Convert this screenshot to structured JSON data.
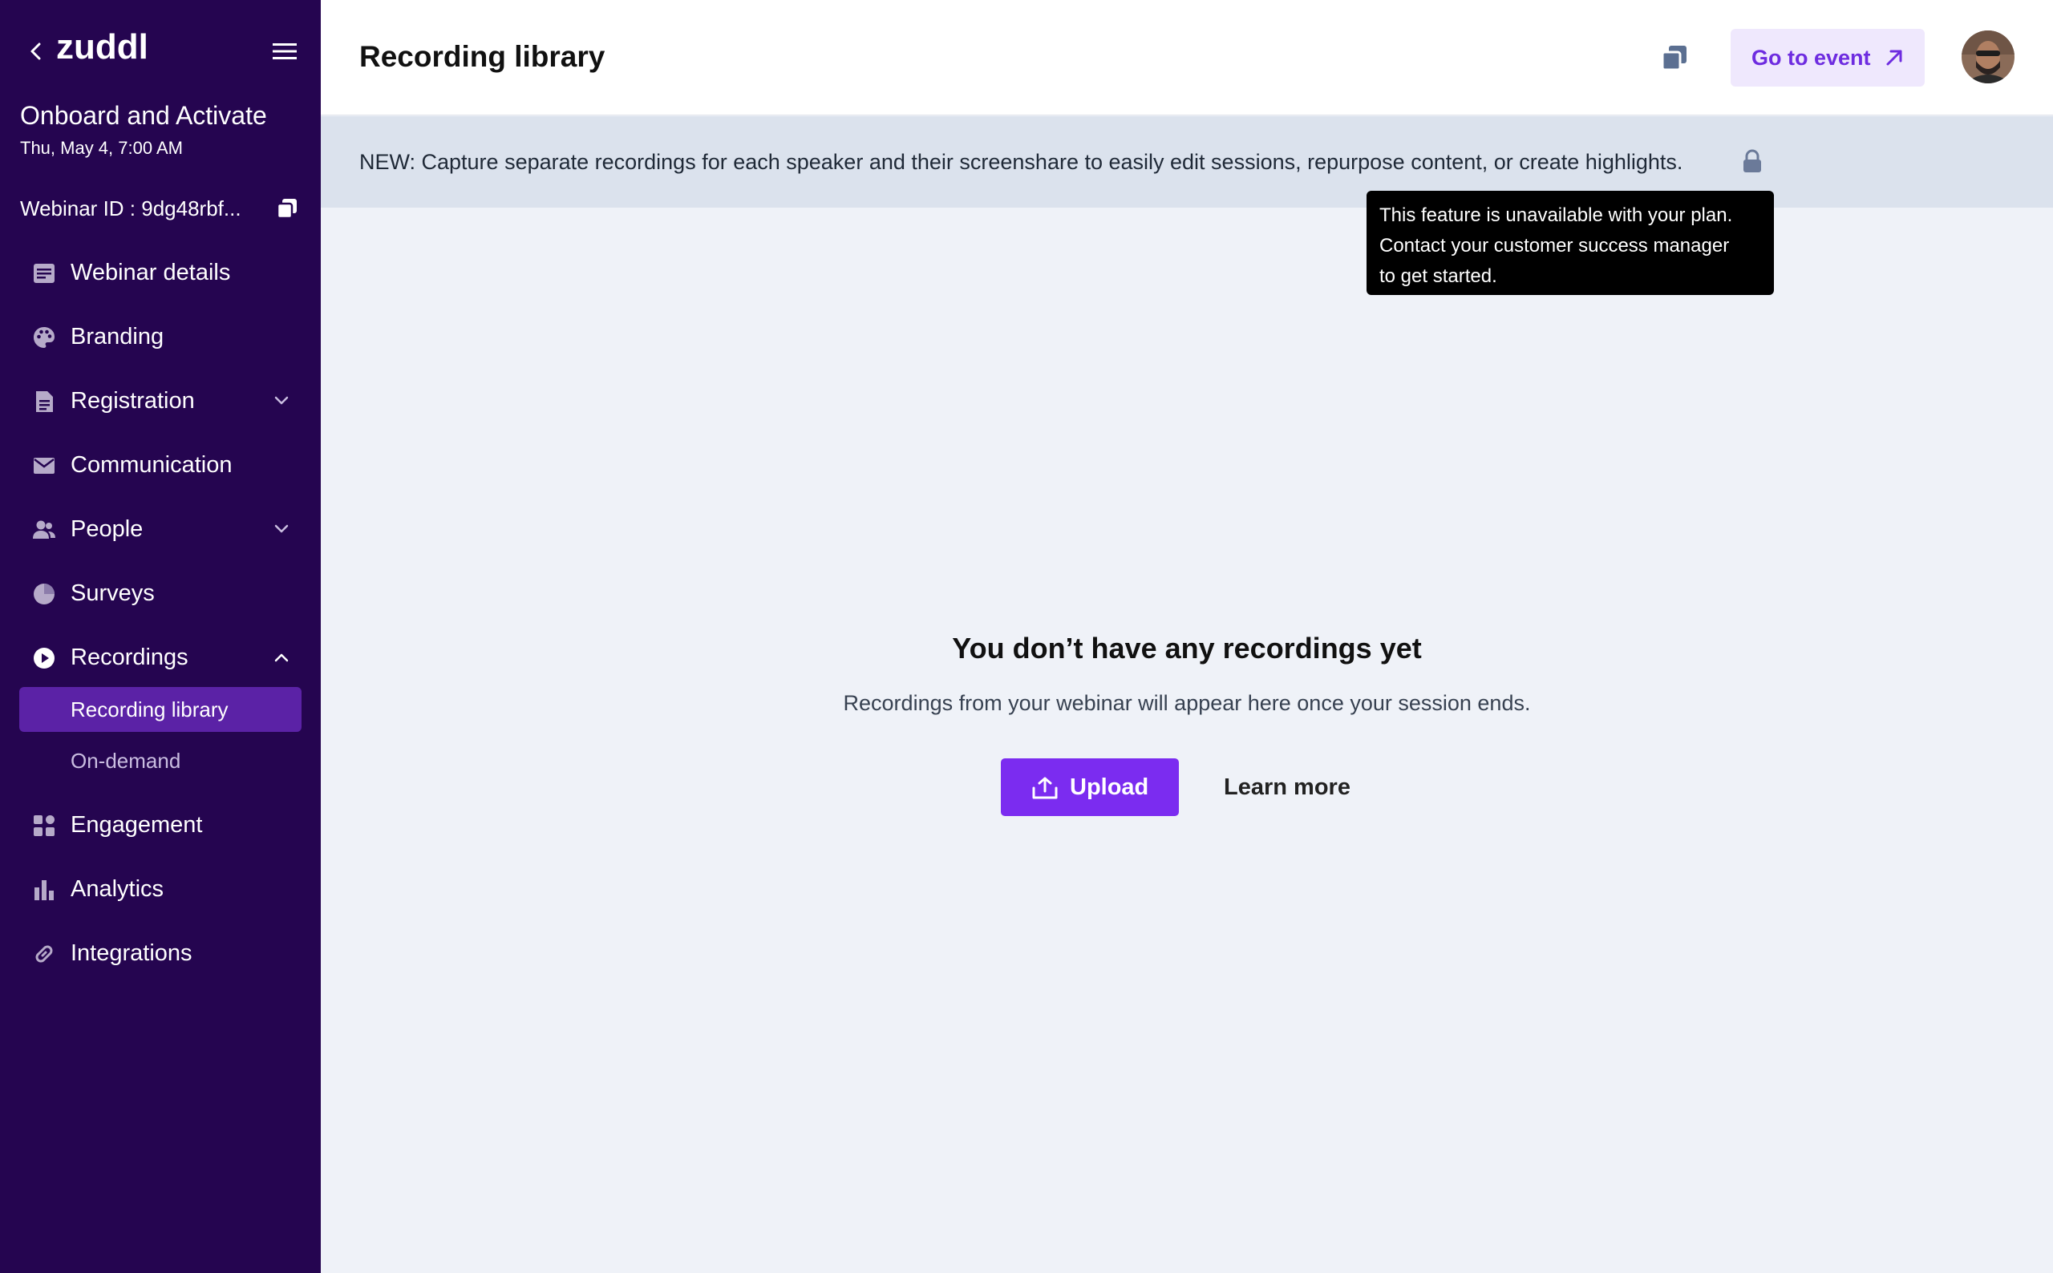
{
  "brand": {
    "logo_text": "zuddl",
    "accent": "#7b2cf0",
    "sidebar_bg": "#250550",
    "sidebar_active_bg": "#5b22a6"
  },
  "sidebar": {
    "event_title": "Onboard and Activate",
    "event_date": "Thu, May 4, 7:00 AM",
    "webinar_id": "Webinar ID : 9dg48rbf...",
    "nav": [
      {
        "label": "Webinar details",
        "icon": "document-icon"
      },
      {
        "label": "Branding",
        "icon": "palette-icon"
      },
      {
        "label": "Registration",
        "icon": "form-icon",
        "expandable": true
      },
      {
        "label": "Communication",
        "icon": "mail-icon"
      },
      {
        "label": "People",
        "icon": "people-icon",
        "expandable": true
      },
      {
        "label": "Surveys",
        "icon": "pie-icon"
      },
      {
        "label": "Recordings",
        "icon": "play-icon",
        "expanded": true
      },
      {
        "label": "Engagement",
        "icon": "grid-icon"
      },
      {
        "label": "Analytics",
        "icon": "bar-chart-icon"
      },
      {
        "label": "Integrations",
        "icon": "link-icon"
      }
    ],
    "recordings_sub": [
      {
        "label": "Recording library",
        "active": true
      },
      {
        "label": "On-demand",
        "active": false
      }
    ]
  },
  "header": {
    "title": "Recording library",
    "go_to_event": "Go to event"
  },
  "banner": {
    "text": "NEW: Capture separate recordings for each speaker and their screenshare to easily edit sessions, repurpose content, or create highlights."
  },
  "tooltip": {
    "lines": [
      "This feature is unavailable with your plan.",
      "Contact your customer success manager",
      "to get started."
    ]
  },
  "empty_state": {
    "title": "You don’t have any recordings yet",
    "description": "Recordings from your webinar will appear here once your session ends.",
    "upload_label": "Upload",
    "learn_more_label": "Learn more"
  }
}
